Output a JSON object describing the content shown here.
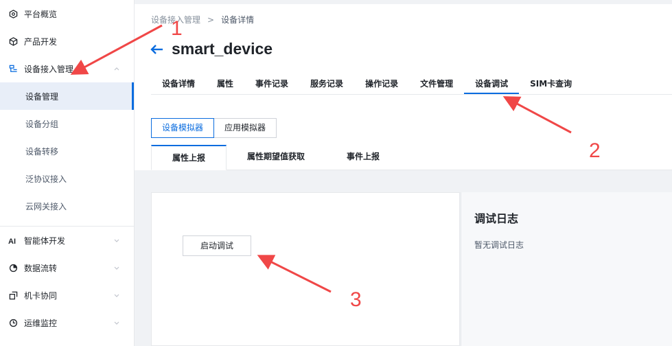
{
  "sidebar": {
    "items": [
      {
        "label": "平台概览",
        "icon": "overview-icon"
      },
      {
        "label": "产品开发",
        "icon": "cube-icon"
      },
      {
        "label": "设备接入管理",
        "icon": "device-access-icon",
        "expanded": true
      },
      {
        "label": "智能体开发",
        "icon": "ai-icon"
      },
      {
        "label": "数据流转",
        "icon": "dataflow-icon"
      },
      {
        "label": "机卡协同",
        "icon": "card-sync-icon"
      },
      {
        "label": "运维监控",
        "icon": "monitor-icon"
      }
    ],
    "subitems": [
      "设备管理",
      "设备分组",
      "设备转移",
      "泛协议接入",
      "云网关接入"
    ],
    "active_sub": "设备管理"
  },
  "breadcrumb": {
    "parent": "设备接入管理",
    "sep": ">",
    "current": "设备详情"
  },
  "page": {
    "title": "smart_device"
  },
  "tabs": [
    "设备详情",
    "属性",
    "事件记录",
    "服务记录",
    "操作记录",
    "文件管理",
    "设备调试",
    "SIM卡查询"
  ],
  "active_tab": "设备调试",
  "simulator": {
    "device": "设备模拟器",
    "app": "应用模拟器"
  },
  "subtabs": [
    "属性上报",
    "属性期望值获取",
    "事件上报"
  ],
  "debug": {
    "start_label": "启动调试",
    "log_title": "调试日志",
    "log_empty": "暂无调试日志"
  },
  "annotations": {
    "n1": "1",
    "n2": "2",
    "n3": "3"
  },
  "colors": {
    "accent": "#0a6cdf",
    "annotation": "#f04747"
  }
}
